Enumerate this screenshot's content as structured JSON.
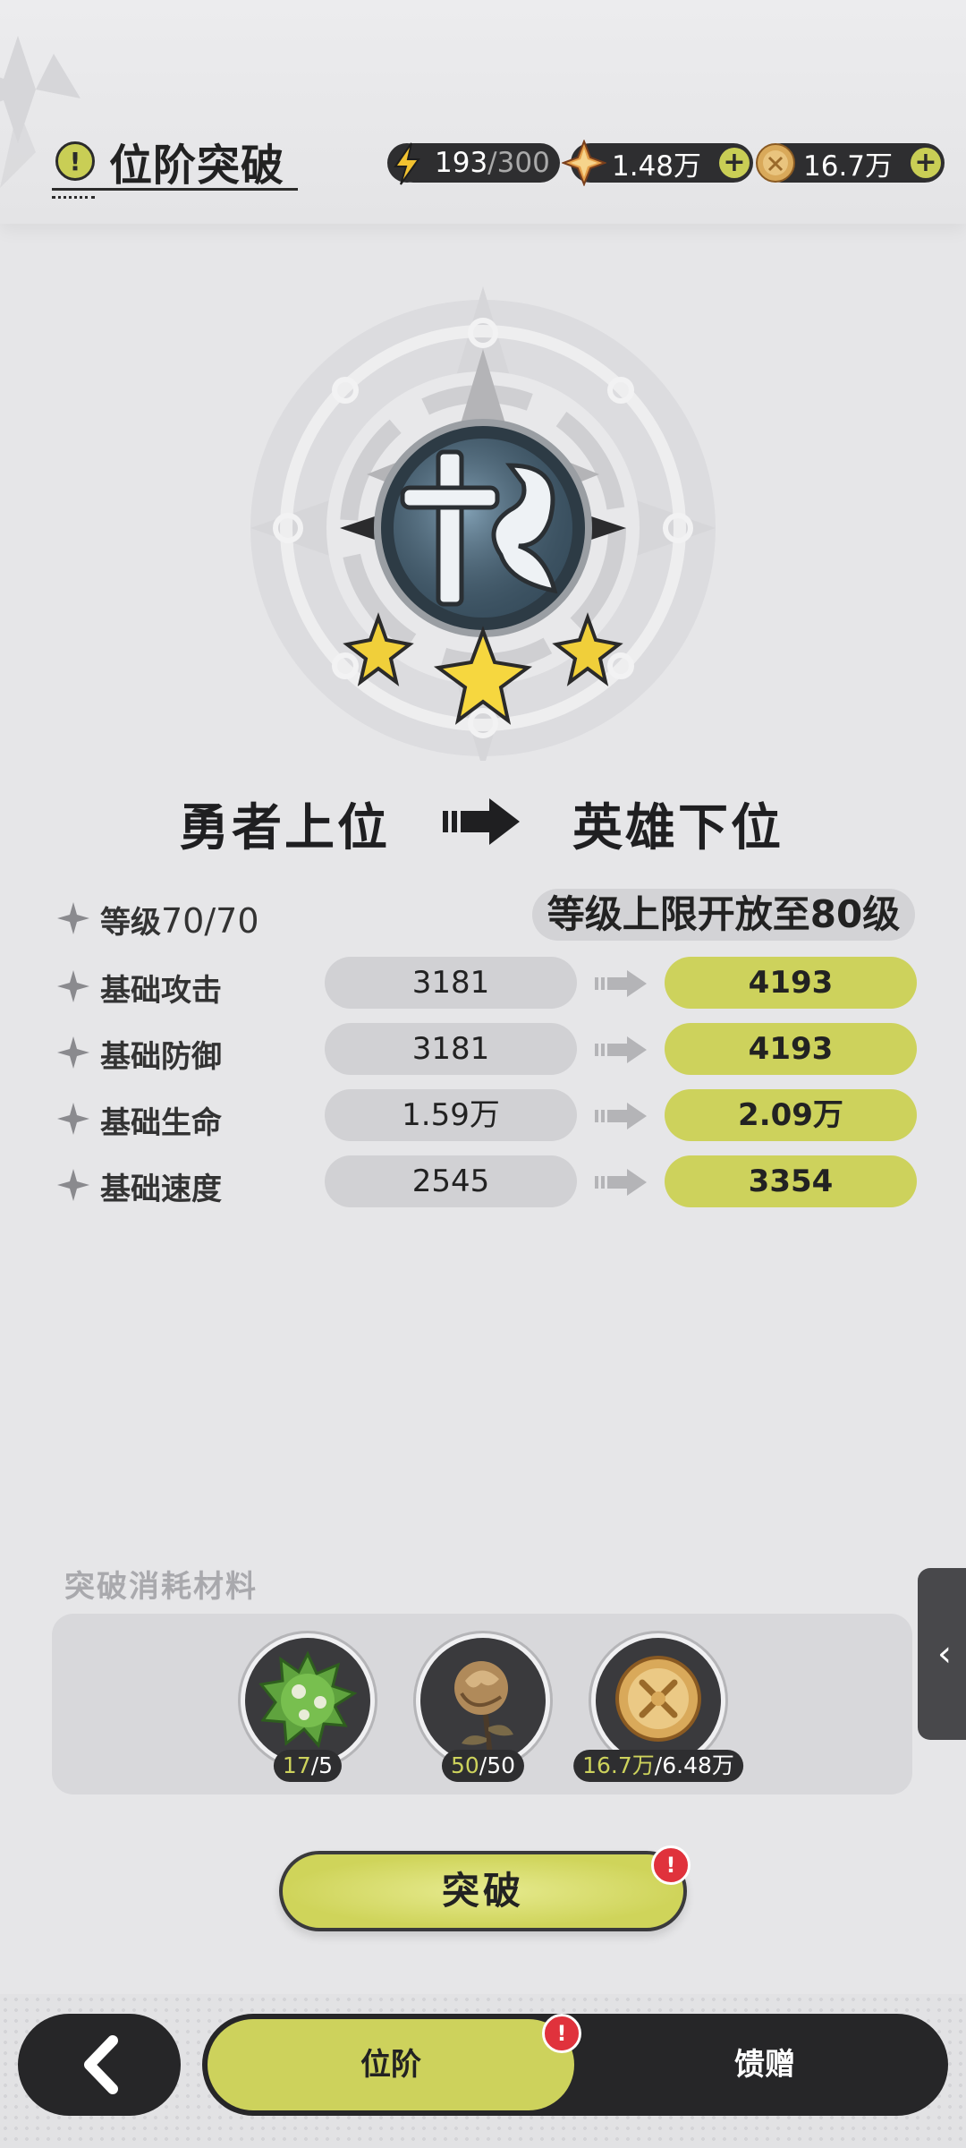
{
  "header": {
    "title": "位阶突破",
    "title_icon": "!",
    "resources": [
      {
        "icon": "lightning-icon",
        "current": "193",
        "max": "/300"
      },
      {
        "icon": "crystal-icon",
        "value": "1.48万",
        "plus": "+"
      },
      {
        "icon": "coin-icon",
        "value": "16.7万",
        "plus": "+"
      }
    ]
  },
  "rank": {
    "from": "勇者上位",
    "to": "英雄下位",
    "stars": 3
  },
  "level": {
    "label": "等级",
    "value": "70/70",
    "note": "等级上限开放至80级"
  },
  "stats": [
    {
      "label": "基础攻击",
      "old": "3181",
      "new": "4193"
    },
    {
      "label": "基础防御",
      "old": "3181",
      "new": "4193"
    },
    {
      "label": "基础生命",
      "old": "1.59万",
      "new": "2.09万"
    },
    {
      "label": "基础速度",
      "old": "2545",
      "new": "3354"
    }
  ],
  "materials": {
    "heading": "突破消耗材料",
    "items": [
      {
        "icon": "green-spiked-orb-icon",
        "have": "17",
        "need": "/5"
      },
      {
        "icon": "bronze-rose-icon",
        "have": "50",
        "need": "/50"
      },
      {
        "icon": "gold-coin-icon",
        "have": "16.7万",
        "need": "/6.48万"
      }
    ]
  },
  "break_button": {
    "label": "突破",
    "badge": "!"
  },
  "side_tab": {
    "glyph": "‹"
  },
  "bottom_nav": {
    "tabs": [
      {
        "label": "位阶",
        "active": true,
        "badge": "!"
      },
      {
        "label": "馈赠",
        "active": false
      }
    ]
  },
  "colors": {
    "accent": "#cdd25c",
    "dark": "#262628",
    "badge_red": "#e0323c",
    "background": "#e6e6e8"
  }
}
